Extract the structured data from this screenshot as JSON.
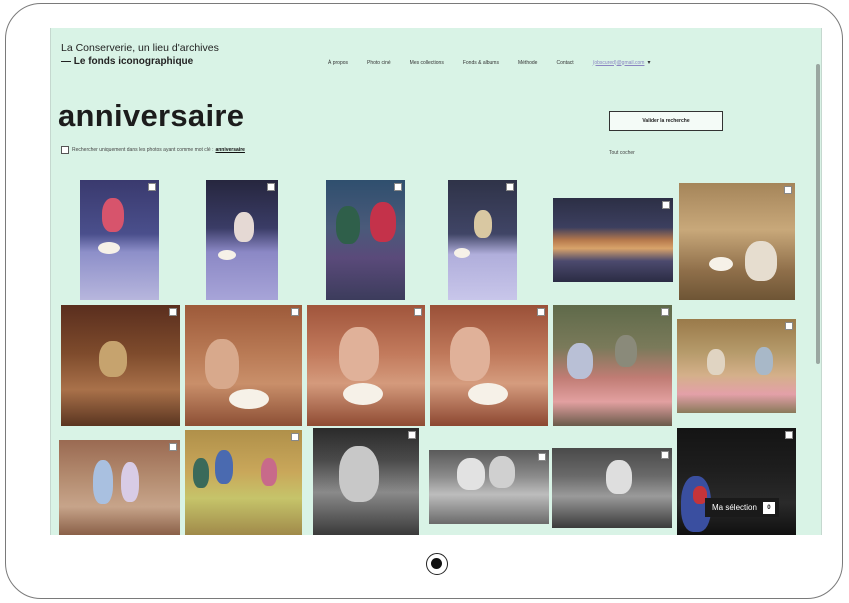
{
  "site": {
    "name": "La Conserverie, un lieu d'archives",
    "section": "— Le fonds iconographique"
  },
  "nav": {
    "items": [
      "À propos",
      "Photo ciné",
      "Mes collections",
      "Fonds & albums",
      "Méthode",
      "Contact"
    ],
    "user_email": "(obscured)@gmail.com"
  },
  "search": {
    "term": "anniversaire",
    "filter_label": "Rechercher uniquement dans les photos ayant comme mot clé :",
    "filter_term": "anniversaire",
    "validate_label": "Valider la recherche",
    "select_all_label": "Tout cocher"
  },
  "selection": {
    "label": "Ma sélection",
    "count": "0"
  },
  "colors": {
    "page_background": "#d9f3e6",
    "text": "#1c1c1c",
    "email_link": "#8b85c2"
  },
  "photos": [
    "birthday-photo-1",
    "birthday-photo-2",
    "birthday-photo-3",
    "birthday-photo-4",
    "birthday-photo-5",
    "birthday-photo-6",
    "birthday-photo-7",
    "birthday-photo-8",
    "birthday-photo-9",
    "birthday-photo-10",
    "birthday-photo-11",
    "birthday-photo-12",
    "birthday-photo-13",
    "birthday-photo-14",
    "birthday-photo-15",
    "birthday-photo-16",
    "birthday-photo-17",
    "birthday-photo-18"
  ]
}
